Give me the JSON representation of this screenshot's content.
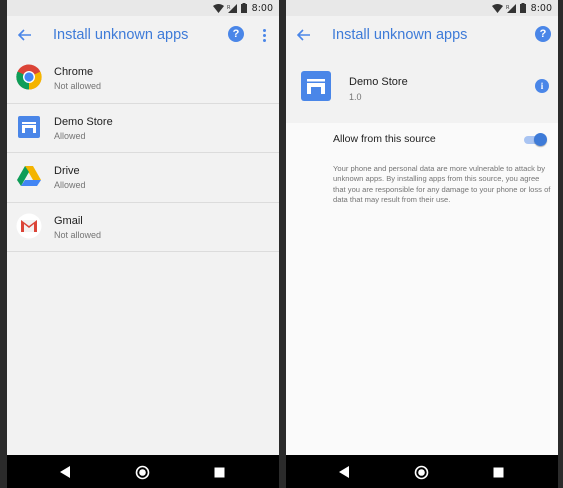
{
  "status_bar": {
    "time": "8:00",
    "network": "R"
  },
  "left_screen": {
    "title": "Install unknown apps",
    "apps": [
      {
        "name": "Chrome",
        "status": "Not allowed",
        "icon": "chrome-icon"
      },
      {
        "name": "Demo Store",
        "status": "Allowed",
        "icon": "store-icon"
      },
      {
        "name": "Drive",
        "status": "Allowed",
        "icon": "drive-icon"
      },
      {
        "name": "Gmail",
        "status": "Not allowed",
        "icon": "gmail-icon"
      }
    ]
  },
  "right_screen": {
    "title": "Install unknown apps",
    "app_name": "Demo Store",
    "app_version": "1.0",
    "allow_label": "Allow from this source",
    "allow_enabled": true,
    "warning": "Your phone and personal data are more vulnerable to attack by unknown apps. By installing apps from this source, you agree that you are responsible for any damage to your phone or loss of data that may result from their use."
  },
  "colors": {
    "accent": "#3e7bd8",
    "icon_blue": "#4a86e8",
    "background": "#f2f2f2",
    "frame": "#2b2b2b"
  },
  "icons": {
    "back": "arrow-left-icon",
    "help": "help-icon",
    "more": "more-vert-icon",
    "info": "info-icon",
    "nav_back": "triangle-back-icon",
    "nav_home": "circle-home-icon",
    "nav_recents": "square-recents-icon"
  }
}
